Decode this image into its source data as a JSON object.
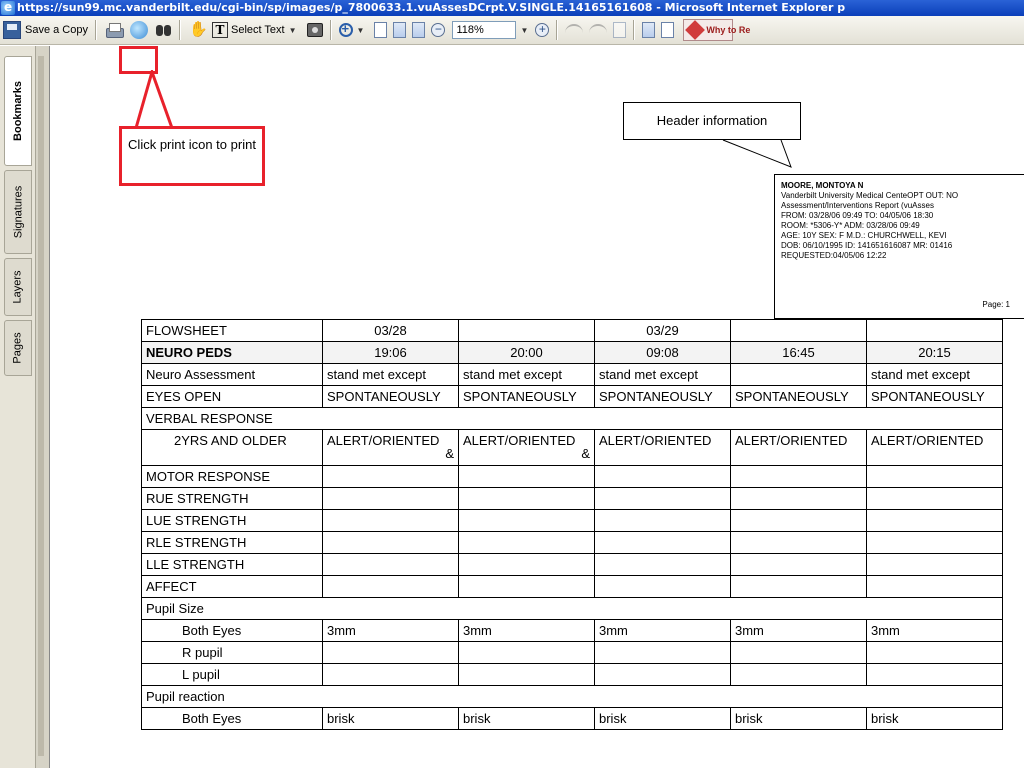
{
  "window": {
    "title": "https://sun99.mc.vanderbilt.edu/cgi-bin/sp/images/p_7800633.1.vuAssesDCrpt.V.SINGLE.14165161608 - Microsoft Internet Explorer p"
  },
  "toolbar": {
    "save_copy_label": "Save a Copy",
    "select_text_label": "Select Text",
    "zoom_value": "118%",
    "why_label": "Why to Re"
  },
  "sidebar": {
    "tabs": [
      "Bookmarks",
      "Signatures",
      "Layers",
      "Pages"
    ]
  },
  "annotations": {
    "print_callout": "Click print icon to print",
    "header_callout": "Header information"
  },
  "patient": {
    "name": "MOORE, MONTOYA N",
    "line1": "Vanderbilt University Medical CenteOPT OUT: NO",
    "line2": "Assessment/Interventions Report (vuAsses",
    "line3": "FROM: 03/28/06 09:49  TO: 04/05/06 18:30",
    "line4": "ROOM: *5306-Y*   ADM: 03/28/06 09:49",
    "line5": "AGE: 10Y   SEX: F   M.D.: CHURCHWELL, KEVI",
    "line6": "DOB: 06/10/1995  ID: 141651616087   MR: 01416",
    "line7": "REQUESTED:04/05/06 12:22",
    "page": "Page: 1"
  },
  "flowsheet": {
    "title": "FLOWSHEET",
    "section": "NEURO PEDS",
    "dates": [
      "03/28",
      "",
      "03/29",
      "",
      ""
    ],
    "times": [
      "19:06",
      "20:00",
      "09:08",
      "16:45",
      "20:15"
    ],
    "rows": [
      {
        "label": "Neuro Assessment",
        "values": [
          "stand met except",
          "stand met except",
          "stand met except",
          "",
          "stand met except"
        ]
      },
      {
        "label": "EYES OPEN",
        "values": [
          "SPONTANEOUSLY",
          "SPONTANEOUSLY",
          "SPONTANEOUSLY",
          "SPONTANEOUSLY",
          "SPONTANEOUSLY"
        ]
      },
      {
        "label": "VERBAL RESPONSE",
        "values": []
      },
      {
        "label": "2YRS AND OLDER",
        "values": [
          "ALERT/ORIENTED",
          "ALERT/ORIENTED",
          "ALERT/ORIENTED",
          "ALERT/ORIENTED",
          "ALERT/ORIENTED"
        ],
        "extra": [
          "&",
          "&",
          "",
          "",
          ""
        ]
      },
      {
        "label": "MOTOR RESPONSE",
        "values": [
          "",
          "",
          "",
          "",
          ""
        ]
      },
      {
        "label": "RUE STRENGTH",
        "values": [
          "",
          "",
          "",
          "",
          ""
        ]
      },
      {
        "label": "LUE STRENGTH",
        "values": [
          "",
          "",
          "",
          "",
          ""
        ]
      },
      {
        "label": "RLE STRENGTH",
        "values": [
          "",
          "",
          "",
          "",
          ""
        ]
      },
      {
        "label": "LLE STRENGTH",
        "values": [
          "",
          "",
          "",
          "",
          ""
        ]
      },
      {
        "label": "AFFECT",
        "values": [
          "",
          "",
          "",
          "",
          ""
        ]
      },
      {
        "label": "Pupil Size",
        "values": []
      },
      {
        "label": "Both Eyes",
        "values": [
          "3mm",
          "3mm",
          "3mm",
          "3mm",
          "3mm"
        ]
      },
      {
        "label": "R pupil",
        "values": [
          "",
          "",
          "",
          "",
          ""
        ]
      },
      {
        "label": "L pupil",
        "values": [
          "",
          "",
          "",
          "",
          ""
        ]
      },
      {
        "label": "Pupil reaction",
        "values": []
      },
      {
        "label": "Both Eyes",
        "values": [
          "brisk",
          "brisk",
          "brisk",
          "brisk",
          "brisk"
        ]
      }
    ]
  }
}
